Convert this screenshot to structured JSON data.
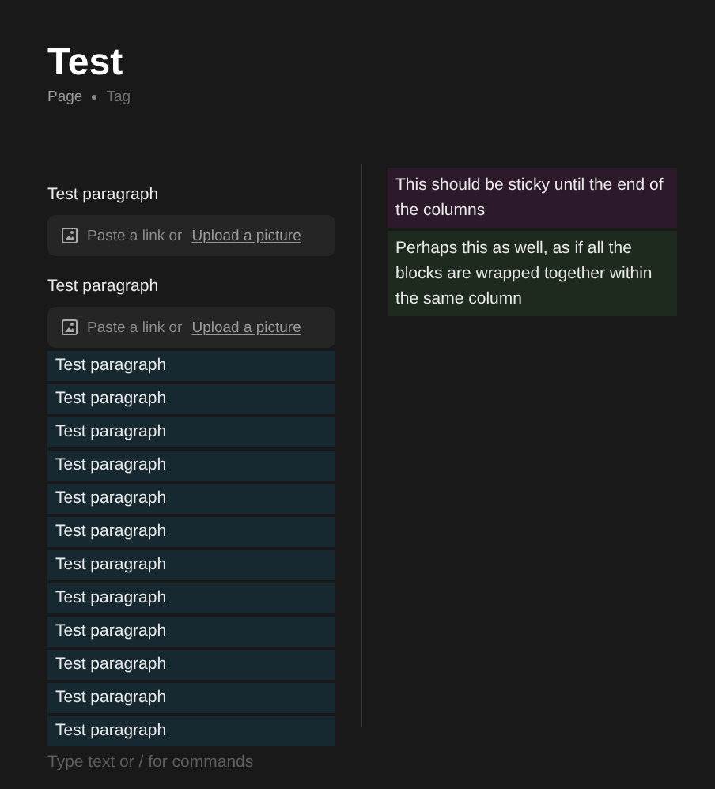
{
  "title": "Test",
  "meta": [
    "Page",
    "Tag"
  ],
  "left_column": [
    {
      "kind": "text",
      "text": "Test paragraph"
    },
    {
      "kind": "image",
      "prompt": "Paste a link or",
      "link": "Upload a picture"
    },
    {
      "kind": "text",
      "text": "Test paragraph"
    },
    {
      "kind": "image",
      "prompt": "Paste a link or",
      "link": "Upload a picture"
    },
    {
      "kind": "shaded",
      "text": "Test paragraph",
      "color": "#172930"
    },
    {
      "kind": "shaded",
      "text": "Test paragraph",
      "color": "#172930"
    },
    {
      "kind": "shaded",
      "text": "Test paragraph",
      "color": "#172930"
    },
    {
      "kind": "shaded",
      "text": "Test paragraph",
      "color": "#172930"
    },
    {
      "kind": "shaded",
      "text": "Test paragraph",
      "color": "#172930"
    },
    {
      "kind": "shaded",
      "text": "Test paragraph",
      "color": "#172930"
    },
    {
      "kind": "shaded",
      "text": "Test paragraph",
      "color": "#172930"
    },
    {
      "kind": "shaded",
      "text": "Test paragraph",
      "color": "#172930"
    },
    {
      "kind": "shaded",
      "text": "Test paragraph",
      "color": "#172930"
    },
    {
      "kind": "shaded",
      "text": "Test paragraph",
      "color": "#172930"
    },
    {
      "kind": "shaded",
      "text": "Test paragraph",
      "color": "#172930"
    },
    {
      "kind": "shaded",
      "text": "Test paragraph",
      "color": "#172930"
    }
  ],
  "right_column": [
    {
      "kind": "shaded",
      "text": "This should be sticky until the end of the columns",
      "color": "#2c1a2a"
    },
    {
      "kind": "shaded",
      "text": "Perhaps this as well, as if all the blocks are wrapped together within the same column",
      "color": "#1e2a1e"
    }
  ],
  "editor": {
    "placeholder": "Type text or / for commands"
  }
}
